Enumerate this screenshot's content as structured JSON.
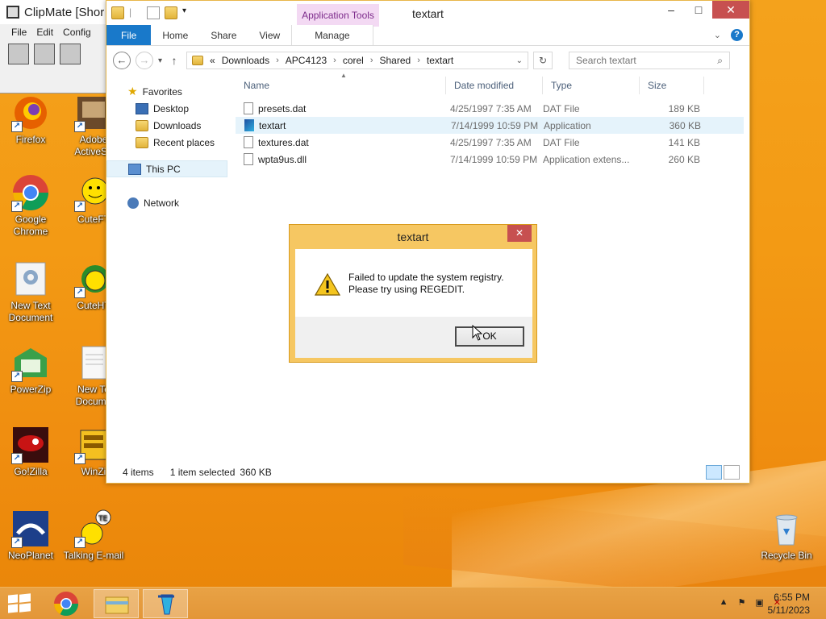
{
  "clipmate": {
    "title": "ClipMate [Shor",
    "menu": [
      "File",
      "Edit",
      "Config"
    ]
  },
  "desktop_icons": [
    {
      "label": "Firefox",
      "icon": "firefox-icon"
    },
    {
      "label": "Adobe ActiveSh",
      "icon": "adobe-activeshare-icon"
    },
    {
      "label": "Google Chrome",
      "icon": "chrome-icon"
    },
    {
      "label": "CuteFT",
      "icon": "cuteftp-icon"
    },
    {
      "label": "New Text Document",
      "icon": "gear-document-icon"
    },
    {
      "label": "CuteHT",
      "icon": "cutehtml-icon"
    },
    {
      "label": "PowerZip",
      "icon": "powerzip-icon"
    },
    {
      "label": "New Te Docume",
      "icon": "text-document-icon"
    },
    {
      "label": "Go!Zilla",
      "icon": "gozilla-icon"
    },
    {
      "label": "WinZi",
      "icon": "winzip-icon"
    },
    {
      "label": "NeoPlanet",
      "icon": "neoplanet-icon"
    },
    {
      "label": "Talking E-mail",
      "icon": "talking-email-icon"
    },
    {
      "label": "Recycle Bin",
      "icon": "recycle-bin-icon"
    }
  ],
  "explorer": {
    "title": "textart",
    "app_tools": "Application Tools",
    "tabs": {
      "file": "File",
      "home": "Home",
      "share": "Share",
      "view": "View",
      "manage": "Manage"
    },
    "breadcrumb": [
      "«",
      "Downloads",
      "APC4123",
      "corel",
      "Shared",
      "textart"
    ],
    "search_placeholder": "Search textart",
    "nav": {
      "favorites": "Favorites",
      "desktop": "Desktop",
      "downloads": "Downloads",
      "recent": "Recent places",
      "this_pc": "This PC",
      "network": "Network"
    },
    "columns": {
      "name": "Name",
      "date": "Date modified",
      "type": "Type",
      "size": "Size"
    },
    "files": [
      {
        "name": "presets.dat",
        "date": "4/25/1997 7:35 AM",
        "type": "DAT File",
        "size": "189 KB"
      },
      {
        "name": "textart",
        "date": "7/14/1999 10:59 PM",
        "type": "Application",
        "size": "360 KB"
      },
      {
        "name": "textures.dat",
        "date": "4/25/1997 7:35 AM",
        "type": "DAT File",
        "size": "141 KB"
      },
      {
        "name": "wpta9us.dll",
        "date": "7/14/1999 10:59 PM",
        "type": "Application extens...",
        "size": "260 KB"
      }
    ],
    "status": {
      "count": "4 items",
      "selected": "1 item selected",
      "size": "360 KB"
    }
  },
  "dialog": {
    "title": "textart",
    "line1": "Failed to update the system registry.",
    "line2": "Please try using REGEDIT.",
    "ok": "OK"
  },
  "taskbar": {
    "time": "6:55 PM",
    "date": "5/11/2023"
  },
  "colors": {
    "accent": "#1979ca",
    "app_tools": "#f3d9f3",
    "close": "#c75050",
    "dialog_frame": "#f6c762"
  }
}
